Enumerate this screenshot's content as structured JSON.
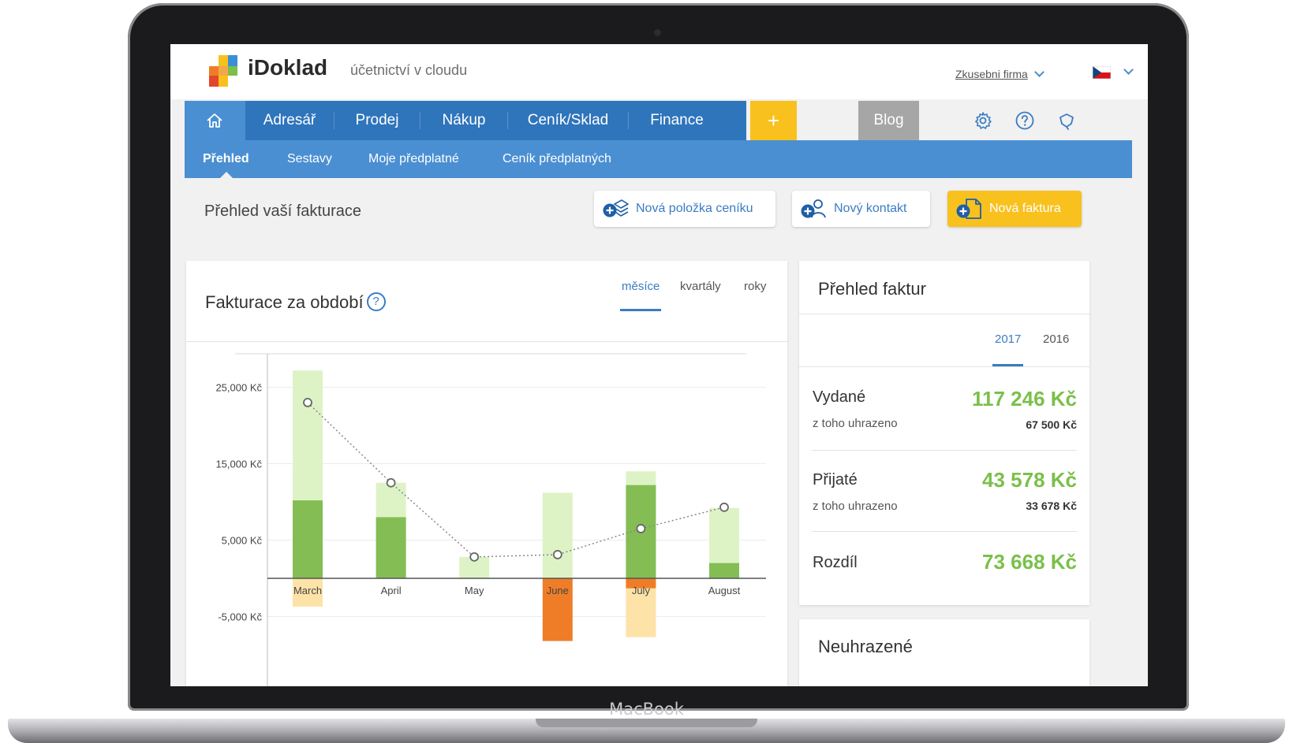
{
  "device": {
    "label": "MacBook"
  },
  "header": {
    "brand": "iDoklad",
    "tagline": "účetnictví v cloudu",
    "company": "Zkusebni firma"
  },
  "nav": {
    "items": [
      "Adresář",
      "Prodej",
      "Nákup",
      "Ceník/Sklad",
      "Finance"
    ],
    "plus": "+",
    "blog": "Blog"
  },
  "subnav": {
    "items": [
      "Přehled",
      "Sestavy",
      "Moje předplatné",
      "Ceník předplatných"
    ]
  },
  "page": {
    "title": "Přehled vaší fakturace",
    "actions": {
      "new_item": "Nová položka ceníku",
      "new_contact": "Nový kontakt",
      "new_invoice": "Nová faktura"
    }
  },
  "chart_card": {
    "title": "Fakturace za období",
    "help": "?",
    "tabs": [
      "měsíce",
      "kvartály",
      "roky"
    ],
    "active_tab": "měsíce"
  },
  "chart_data": {
    "type": "bar",
    "categories": [
      "March",
      "April",
      "May",
      "June",
      "July",
      "August"
    ],
    "y_tick_labels": [
      "25,000 Kč",
      "15,000 Kč",
      "5,000 Kč",
      "-5,000 Kč"
    ],
    "y_ticks": [
      25000,
      15000,
      5000,
      -5000
    ],
    "ylim": [
      -8500,
      29500
    ],
    "series": [
      {
        "values": [
          10200,
          8000,
          0,
          0,
          12200,
          2000
        ]
      },
      {
        "values": [
          27200,
          12500,
          2800,
          11200,
          14000,
          9200
        ]
      },
      {
        "values": [
          0,
          0,
          0,
          -8200,
          -1300,
          0
        ]
      },
      {
        "values": [
          -3700,
          0,
          0,
          0,
          -7700,
          0
        ]
      },
      {
        "values": [
          23000,
          12500,
          2800,
          3100,
          6500,
          9300
        ]
      }
    ],
    "colors": {
      "paid": "#84bd54",
      "issued": "#ddf3c6",
      "unpaid": "#ef7d27",
      "received": "#fde3a8",
      "line": "#888888"
    }
  },
  "summary_card": {
    "title": "Přehled faktur",
    "years": [
      "2017",
      "2016"
    ],
    "active_year": "2017",
    "rows": [
      {
        "label": "Vydané",
        "amount": "117 246 Kč",
        "sub": "z toho uhrazeno",
        "paid": "67 500 Kč"
      },
      {
        "label": "Přijaté",
        "amount": "43 578 Kč",
        "sub": "z toho uhrazeno",
        "paid": "33 678 Kč"
      },
      {
        "label": "Rozdíl",
        "amount": "73 668 Kč"
      }
    ]
  },
  "unpaid_card": {
    "title": "Neuhrazené"
  }
}
